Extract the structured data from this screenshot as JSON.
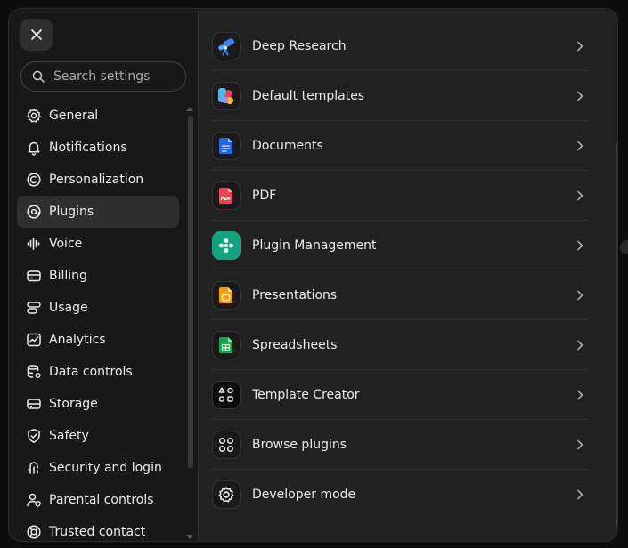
{
  "search": {
    "placeholder": "Search settings"
  },
  "sidebar": {
    "items": [
      {
        "label": "General",
        "icon": "gear-icon"
      },
      {
        "label": "Notifications",
        "icon": "bell-icon"
      },
      {
        "label": "Personalization",
        "icon": "personalization-icon"
      },
      {
        "label": "Plugins",
        "icon": "plugins-icon",
        "active": true
      },
      {
        "label": "Voice",
        "icon": "voice-wave-icon"
      },
      {
        "label": "Billing",
        "icon": "credit-card-icon"
      },
      {
        "label": "Usage",
        "icon": "usage-bars-icon"
      },
      {
        "label": "Analytics",
        "icon": "analytics-chart-icon"
      },
      {
        "label": "Data controls",
        "icon": "database-gear-icon"
      },
      {
        "label": "Storage",
        "icon": "storage-drive-icon"
      },
      {
        "label": "Safety",
        "icon": "shield-check-icon"
      },
      {
        "label": "Security and login",
        "icon": "security-icon"
      },
      {
        "label": "Parental controls",
        "icon": "parental-controls-icon"
      },
      {
        "label": "Trusted contact",
        "icon": "lifebuoy-icon"
      }
    ]
  },
  "plugins": {
    "items": [
      {
        "label": "Deep Research",
        "icon": "telescope-icon"
      },
      {
        "label": "Default templates",
        "icon": "templates-icon"
      },
      {
        "label": "Documents",
        "icon": "document-icon"
      },
      {
        "label": "PDF",
        "icon": "pdf-icon",
        "badge": "PDF"
      },
      {
        "label": "Plugin Management",
        "icon": "plugin-management-icon"
      },
      {
        "label": "Presentations",
        "icon": "presentation-icon"
      },
      {
        "label": "Spreadsheets",
        "icon": "spreadsheet-icon"
      },
      {
        "label": "Template Creator",
        "icon": "template-creator-icon"
      },
      {
        "label": "Browse plugins",
        "icon": "grid-circles-icon"
      },
      {
        "label": "Developer mode",
        "icon": "gear-icon"
      }
    ]
  },
  "colors": {
    "background": "#212121",
    "sidebar": "#181818",
    "active_item": "#2f2f2f",
    "text": "#ececec",
    "plugin_management": "#10a37f",
    "documents_blue": "#2563eb",
    "pdf_red": "#e5484d",
    "presentations_orange": "#f59e0b",
    "spreadsheets_green": "#16a34a",
    "research_blue": "#3b82f6"
  }
}
